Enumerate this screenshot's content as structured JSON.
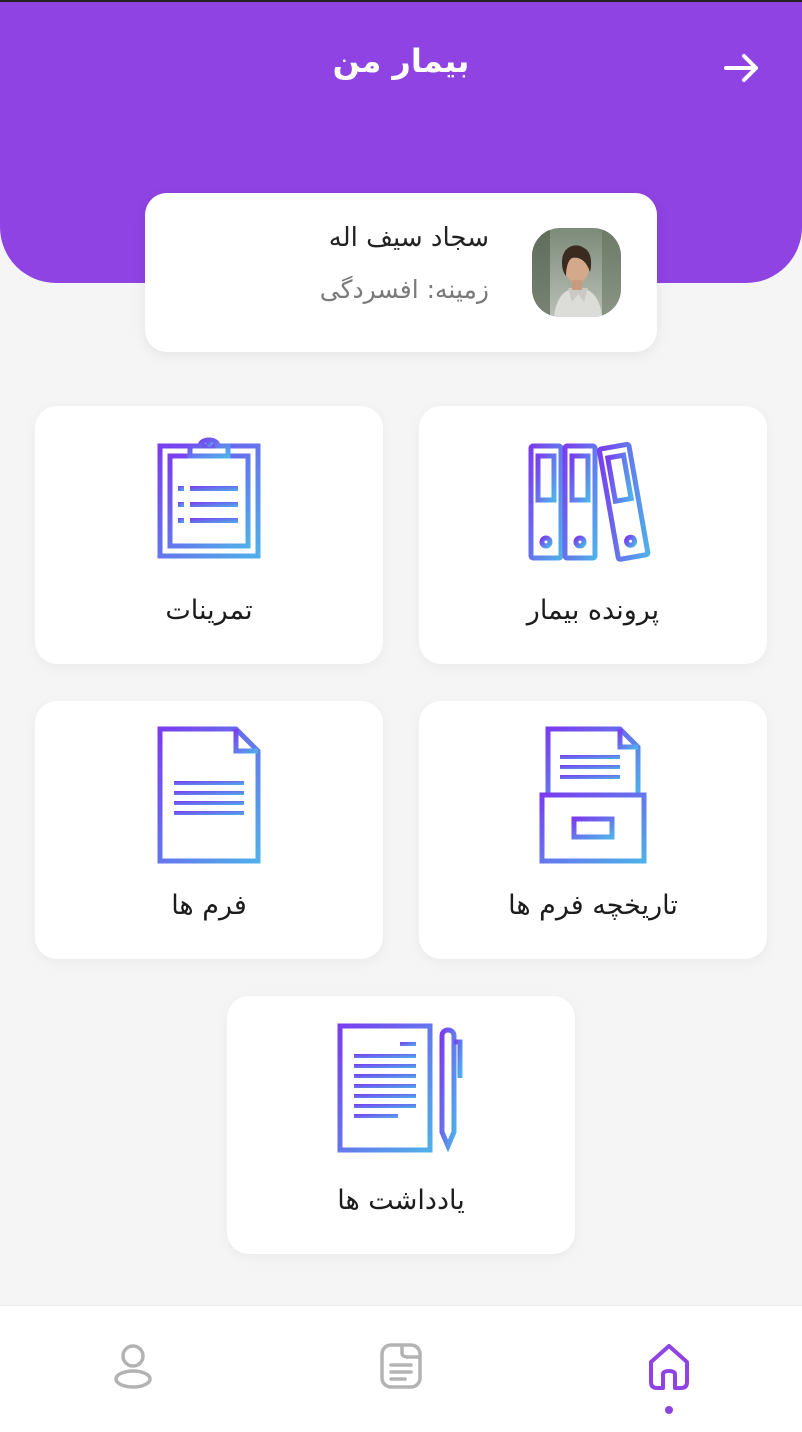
{
  "header": {
    "title": "بیمار من"
  },
  "profile": {
    "name": "سجاد سیف اله",
    "field": "زمینه: افسردگی"
  },
  "tiles": [
    {
      "label": "پرونده بیمار",
      "icon": "binders-icon"
    },
    {
      "label": "تمرینات",
      "icon": "clipboard-icon"
    },
    {
      "label": "تاریخچه فرم ها",
      "icon": "file-box-icon"
    },
    {
      "label": "فرم ها",
      "icon": "document-icon"
    },
    {
      "label": "یادداشت ها",
      "icon": "notes-pen-icon"
    }
  ],
  "nav": {
    "items": [
      {
        "icon": "home-icon",
        "active": true
      },
      {
        "icon": "list-icon",
        "active": false
      },
      {
        "icon": "user-icon",
        "active": false
      }
    ]
  },
  "colors": {
    "accent": "#8f43e3",
    "gradient_start": "#7a3cf0",
    "gradient_end": "#4fb0ea",
    "background": "#f5f5f5"
  }
}
